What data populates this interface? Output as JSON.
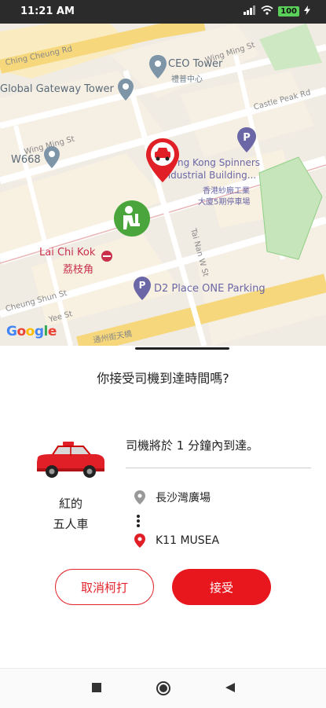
{
  "status_bar": {
    "time": "11:21 AM",
    "battery": "100"
  },
  "map": {
    "labels": {
      "ching_cheung_rd": "Ching Cheung Rd",
      "wing_ming_st_1": "Wing Ming St",
      "ceo_tower": "CEO Tower",
      "ceo_tower_zh": "禮普中心",
      "global_gateway": "Global Gateway Tower",
      "castle_peak_rd": "Castle Peak Rd",
      "wing_ming_st_2": "Wing Ming St",
      "w668": "W668",
      "hk_spinners_1": "ng Kong Spinners",
      "hk_spinners_2": "Industrial Building...",
      "hk_spinners_zh1": "香港紗廠工業",
      "hk_spinners_zh2": "大廈5期停車場",
      "tai_nan_w_st": "Tai Nan W St",
      "lai_chi_kok": "Lai Chi Kok",
      "lai_chi_kok_zh": "荔枝角",
      "d2_parking": "D2 Place ONE Parking",
      "cheung_shun_st": "Cheung Shun St",
      "yee_st": "Yee St",
      "bottom_road": "通州街天橋"
    },
    "attribution": "Google"
  },
  "sheet": {
    "question": "你接受司機到達時間嗎?",
    "vehicle_type_line1": "紅的",
    "vehicle_type_line2": "五人車",
    "eta": "司機將於 1 分鐘內到達。",
    "pickup": "長沙灣廣場",
    "dropoff": "K11 MUSEA",
    "cancel_label": "取消柯打",
    "accept_label": "接受"
  },
  "colors": {
    "accent": "#e8161d",
    "driver_marker": "#4aa63c",
    "parking": "#6b67a6"
  }
}
